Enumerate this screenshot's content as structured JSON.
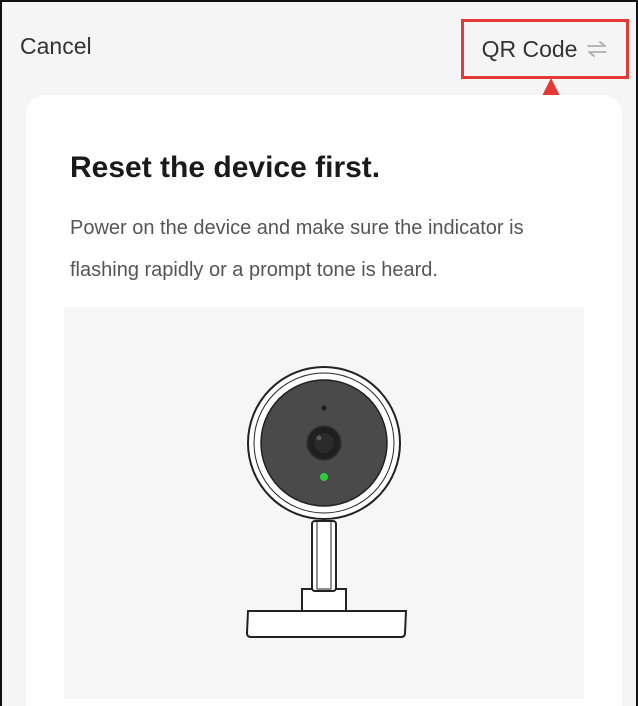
{
  "header": {
    "cancel_label": "Cancel",
    "qr_code_label": "QR Code"
  },
  "content": {
    "title": "Reset the device first.",
    "description": "Power on the device and make sure the indicator is flashing rapidly or a prompt tone is heard."
  },
  "icons": {
    "swap": "swap-arrows-icon",
    "annotation_arrow": "red-arrow-annotation",
    "camera": "camera-illustration"
  },
  "colors": {
    "highlight_red": "#e53935",
    "indicator_green": "#2ecc40",
    "background": "#f5f5f5"
  }
}
